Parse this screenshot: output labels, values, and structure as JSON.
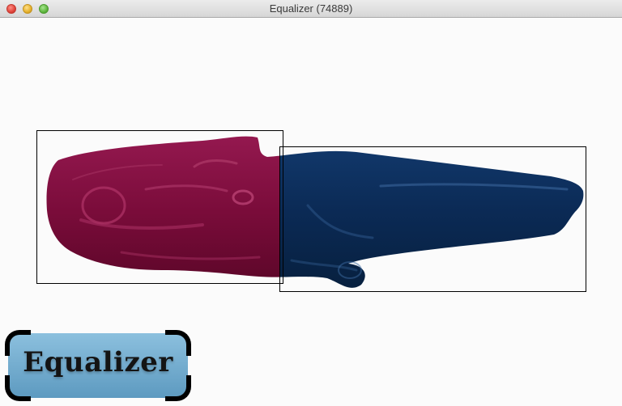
{
  "window": {
    "title": "Equalizer (74889)"
  },
  "logo": {
    "text": "Equalizer"
  },
  "icons": {
    "close": "close-icon",
    "minimize": "minimize-icon",
    "zoom": "zoom-icon"
  },
  "colors": {
    "left_partition": "#7a0c3a",
    "right_partition": "#0b2a55",
    "logo_background": "#6fa8cb",
    "canvas_background": "#fbfbfb"
  }
}
